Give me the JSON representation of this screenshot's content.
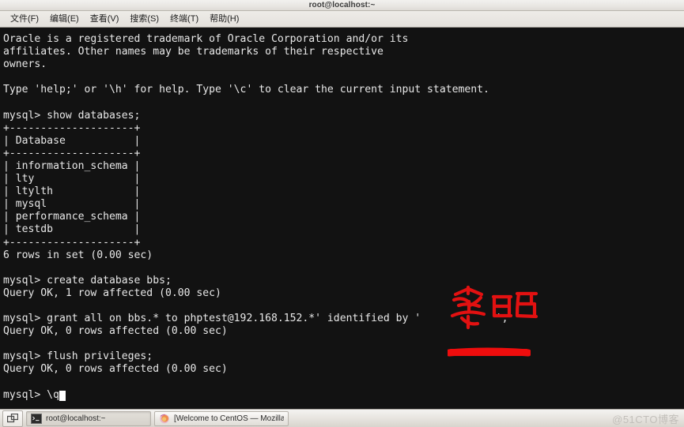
{
  "window": {
    "title": "root@localhost:~"
  },
  "menubar": {
    "items": [
      {
        "label": "文件(F)",
        "name": "menu-file"
      },
      {
        "label": "编辑(E)",
        "name": "menu-edit"
      },
      {
        "label": "查看(V)",
        "name": "menu-view"
      },
      {
        "label": "搜索(S)",
        "name": "menu-search"
      },
      {
        "label": "终端(T)",
        "name": "menu-terminal"
      },
      {
        "label": "帮助(H)",
        "name": "menu-help"
      }
    ]
  },
  "terminal": {
    "prompt": "mysql>",
    "content": "Oracle is a registered trademark of Oracle Corporation and/or its\naffiliates. Other names may be trademarks of their respective\nowners.\n\nType 'help;' or '\\h' for help. Type '\\c' to clear the current input statement.\n\nmysql> show databases;\n+--------------------+\n| Database           |\n+--------------------+\n| information_schema |\n| lty                |\n| ltylth             |\n| mysql              |\n| performance_schema |\n| testdb             |\n+--------------------+\n6 rows in set (0.00 sec)\n\nmysql> create database bbs;\nQuery OK, 1 row affected (0.00 sec)\n\nmysql> grant all on bbs.* to phptest@192.168.152.*' identified by '            ';\nQuery OK, 0 rows affected (0.00 sec)\n\nmysql> flush privileges;\nQuery OK, 0 rows affected (0.00 sec)\n\nmysql> \\q",
    "databases": [
      "information_schema",
      "lty",
      "ltylth",
      "mysql",
      "performance_schema",
      "testdb"
    ],
    "row_count_text": "6 rows in set (0.00 sec)",
    "commands": [
      "show databases;",
      "create database bbs;",
      "grant all on bbs.* to phptest@192.168.152.*' identified by '';",
      "flush privileges;",
      "\\q"
    ],
    "colors": {
      "background": "#121212",
      "foreground": "#e8e8e8",
      "cursor": "#ffffff"
    }
  },
  "annotations": {
    "handwriting_label": "密码",
    "handwriting_color": "#e01010",
    "redaction_color": "#ee0d0d"
  },
  "taskbar": {
    "items": [
      {
        "label": "root@localhost:~",
        "name": "taskbar-item-terminal"
      },
      {
        "label": "[Welcome to CentOS — Mozilla Fir···",
        "name": "taskbar-item-firefox"
      }
    ],
    "watermark": "@51CTO博客"
  }
}
